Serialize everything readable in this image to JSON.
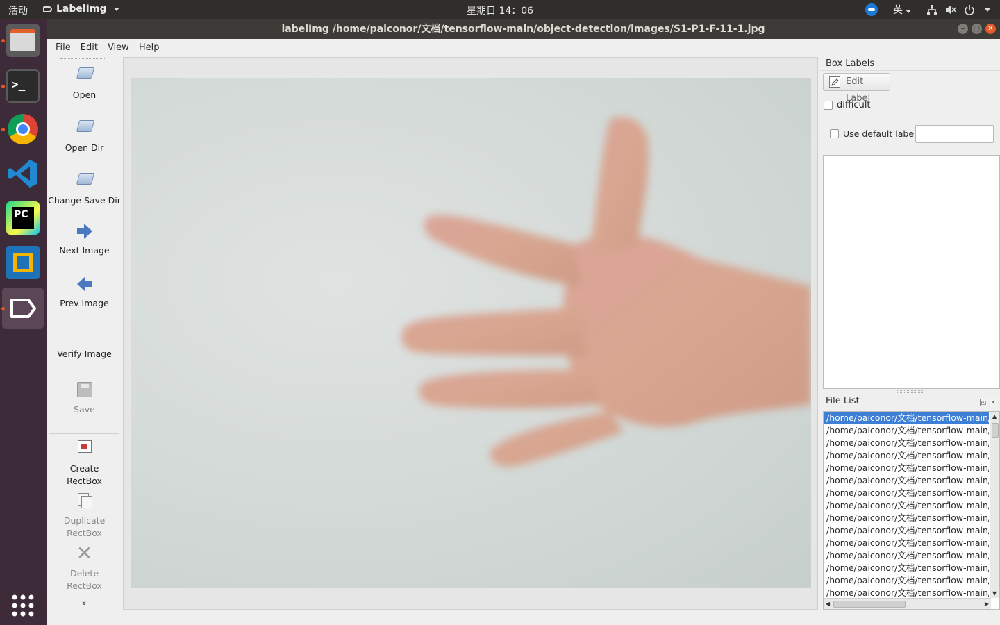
{
  "topbar": {
    "activities": "活动",
    "app_name": "LabelImg",
    "clock": "星期日 14：06",
    "input_method": "英"
  },
  "window": {
    "title": "labelImg /home/paiconor/文档/tensorflow-main/object-detection/images/S1-P1-F-11-1.jpg"
  },
  "dock": {
    "items": [
      "files-icon",
      "terminal-icon",
      "chrome-icon",
      "vscode-icon",
      "pycharm-icon",
      "virtualbox-icon",
      "labelimg-icon",
      "app-grid-icon"
    ]
  },
  "menubar": {
    "items": [
      "File",
      "Edit",
      "View",
      "Help"
    ]
  },
  "toolbar": {
    "open": "Open",
    "open_dir": "Open Dir",
    "change_save_dir": "Change Save Dir",
    "next_image": "Next Image",
    "prev_image": "Prev Image",
    "verify_image": "Verify Image",
    "save": "Save",
    "create_rectbox_1": "Create",
    "create_rectbox_2": "RectBox",
    "duplicate_rectbox_1": "Duplicate",
    "duplicate_rectbox_2": "RectBox",
    "delete_rectbox_1": "Delete",
    "delete_rectbox_2": "RectBox",
    "more": "»"
  },
  "right_panel": {
    "box_labels_title": "Box Labels",
    "edit_label": "Edit Label",
    "difficult": "difficult",
    "use_default_label": "Use default label",
    "default_label_value": "",
    "file_list_title": "File List",
    "files": [
      "/home/paiconor/文档/tensorflow-main/ob",
      "/home/paiconor/文档/tensorflow-main/ob",
      "/home/paiconor/文档/tensorflow-main/ob",
      "/home/paiconor/文档/tensorflow-main/ob",
      "/home/paiconor/文档/tensorflow-main/ob",
      "/home/paiconor/文档/tensorflow-main/ob",
      "/home/paiconor/文档/tensorflow-main/ob",
      "/home/paiconor/文档/tensorflow-main/ob",
      "/home/paiconor/文档/tensorflow-main/ob",
      "/home/paiconor/文档/tensorflow-main/ob",
      "/home/paiconor/文档/tensorflow-main/ob",
      "/home/paiconor/文档/tensorflow-main/ob",
      "/home/paiconor/文档/tensorflow-main/ob",
      "/home/paiconor/文档/tensorflow-main/ob",
      "/home/paiconor/文档/tensorflow-main/ob"
    ]
  },
  "colors": {
    "selection": "#3d7fd6",
    "dock_bg": "#3e2b39",
    "accent_dot": "#e95420"
  }
}
